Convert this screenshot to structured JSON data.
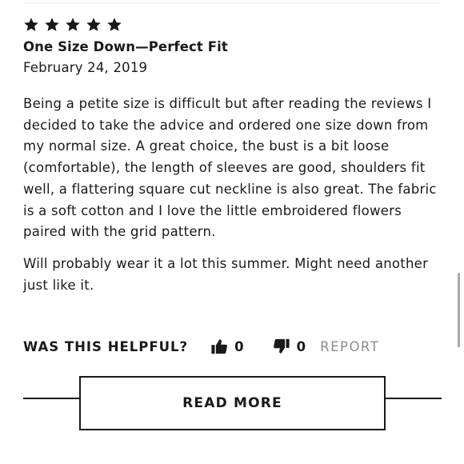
{
  "review": {
    "rating": 5,
    "rating_max": 5,
    "title": "One Size Down—Perfect Fit",
    "date": "February 24, 2019",
    "paragraphs": [
      "Being a petite size is difficult but after reading the reviews I decided to take the advice and ordered one size down from my normal size. A great choice, the bust is a bit loose (comfortable), the length of sleeves are good, shoulders fit well, a flattering square cut neckline is also great. The fabric is a soft cotton and I love the little embroidered flowers paired with the grid pattern.",
      "Will probably wear it a lot this summer. Might need another just like it."
    ]
  },
  "feedback": {
    "question": "WAS THIS HELPFUL?",
    "helpful_count": "0",
    "unhelpful_count": "0",
    "report_label": "REPORT",
    "report_color": "#8c8c8c"
  },
  "read_more_label": "READ MORE",
  "icons": {
    "star": "star-icon",
    "thumbs_up": "thumbs-up-icon",
    "thumbs_down": "thumbs-down-icon"
  },
  "colors": {
    "text": "#1a1a1a",
    "background": "#ffffff"
  }
}
